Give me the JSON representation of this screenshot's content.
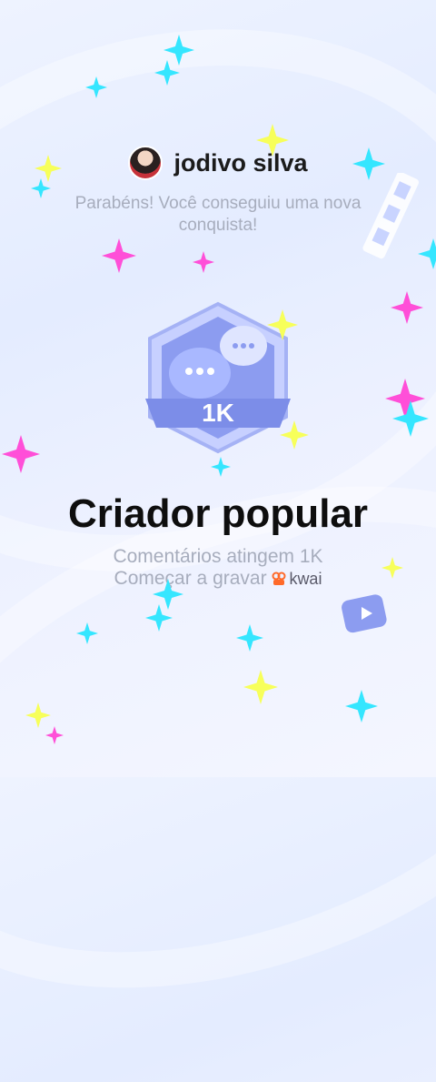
{
  "header": {
    "username": "jodivo silva",
    "message": "Parabéns! Você conseguiu uma nova conquista!"
  },
  "badge": {
    "label": "1K"
  },
  "achievement": {
    "title": "Criador popular",
    "description": "Comentários atingem 1K",
    "record_prompt": "Começar a gravar",
    "brand": "kwai"
  },
  "colors": {
    "badge_main": "#8c9cf0",
    "badge_light": "#c7d0ff",
    "accent_cyan": "#35e6ff",
    "accent_pink": "#ff4fd8",
    "accent_yellow": "#f7ff5a"
  }
}
